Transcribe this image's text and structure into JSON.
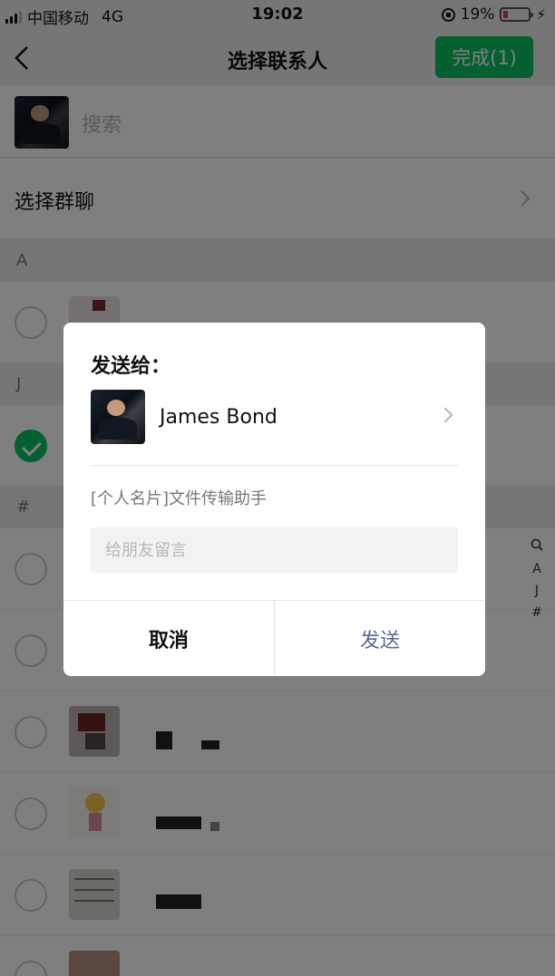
{
  "status_bar": {
    "carrier": "中国移动",
    "network": "4G",
    "time": "19:02",
    "battery": "19%"
  },
  "nav": {
    "title": "选择联系人",
    "done_label": "完成(1)"
  },
  "search": {
    "placeholder": "搜索"
  },
  "group_row": {
    "label": "选择群聊"
  },
  "sections": [
    "A",
    "J",
    "#"
  ],
  "index_bar": [
    "A",
    "J",
    "#"
  ],
  "dialog": {
    "heading": "发送给：",
    "contact_name": "James  Bond",
    "description": "[个人名片]文件传输助手",
    "message_placeholder": "给朋友留言",
    "cancel_label": "取消",
    "send_label": "发送"
  },
  "colors": {
    "accent": "#07c160",
    "send_link": "#576b95",
    "battery_low": "#e23b3b"
  }
}
